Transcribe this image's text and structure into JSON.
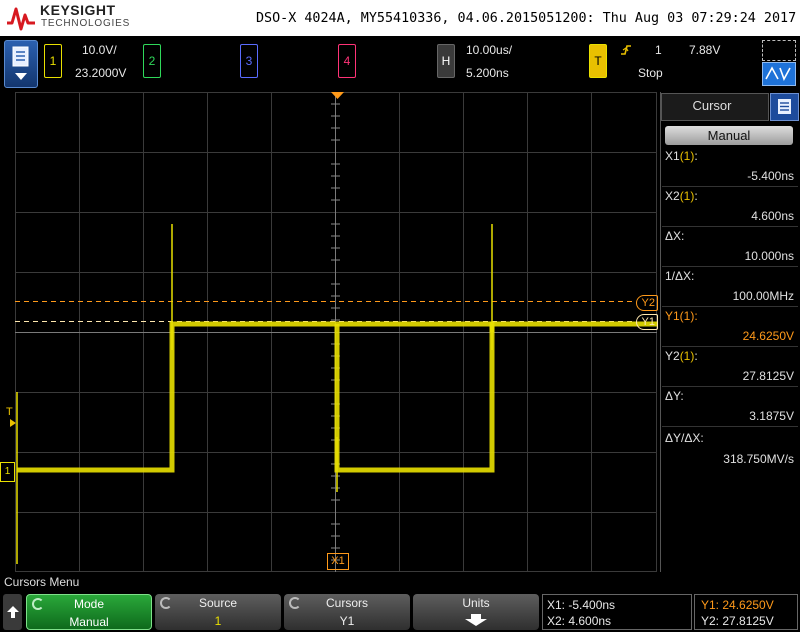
{
  "header": {
    "brand_top": "KEYSIGHT",
    "brand_bottom": "TECHNOLOGIES",
    "title": "DSO-X 4024A, MY55410336, 04.06.2015051200: Thu Aug 03 07:29:24 2017"
  },
  "channels": {
    "ch1": {
      "num": "1",
      "scale": "10.0V/",
      "offset": "23.2000V",
      "color": "#e9e000"
    },
    "ch2": {
      "num": "2",
      "color": "#2fd85a"
    },
    "ch3": {
      "num": "3",
      "color": "#5a6cff"
    },
    "ch4": {
      "num": "4",
      "color": "#ff3377"
    }
  },
  "horizontal": {
    "label": "H",
    "timebase": "10.00us/",
    "delay": "5.200ns"
  },
  "trigger": {
    "label": "T",
    "source": "1",
    "level": "7.88V",
    "status": "Stop"
  },
  "grid_markers": {
    "t_marker": "T",
    "ground_marker": "1",
    "x1_label": "X1",
    "y1_label": "Y1",
    "y2_label": "Y2"
  },
  "cursor_panel": {
    "title": "Cursor",
    "mode_button": "Manual",
    "x1_label": "X1",
    "x1_src": "(1)",
    "x1_colon": ":",
    "x1_value": "-5.400ns",
    "x2_label": "X2",
    "x2_src": "(1)",
    "x2_colon": ":",
    "x2_value": "4.600ns",
    "dx_label": "ΔX:",
    "dx_value": "10.000ns",
    "inv_dx_label": "1/ΔX:",
    "inv_dx_value": "100.00MHz",
    "y1_label": "Y1(1):",
    "y1_value": "24.6250V",
    "y2_label": "Y2",
    "y2_src": "(1)",
    "y2_colon": ":",
    "y2_value": "27.8125V",
    "dy_label": "ΔY:",
    "dy_value": "3.1875V",
    "dydx_label": "ΔY/ΔX:",
    "dydx_value": "318.750MV/s"
  },
  "softkeys": {
    "menu_title": "Cursors Menu",
    "mode": {
      "title": "Mode",
      "value": "Manual"
    },
    "source": {
      "title": "Source",
      "value": "1"
    },
    "cursors": {
      "title": "Cursors",
      "value": "Y1"
    },
    "units": {
      "title": "Units"
    },
    "readout": {
      "x1": "X1: -5.400ns",
      "x2": "X2: 4.600ns",
      "y1": "Y1: 24.6250V",
      "y2": "Y2: 27.8125V"
    }
  },
  "colors": {
    "accent_orange": "#ff9a1a",
    "trace_yellow": "#e9e000",
    "active_green": "#1f9a30"
  }
}
